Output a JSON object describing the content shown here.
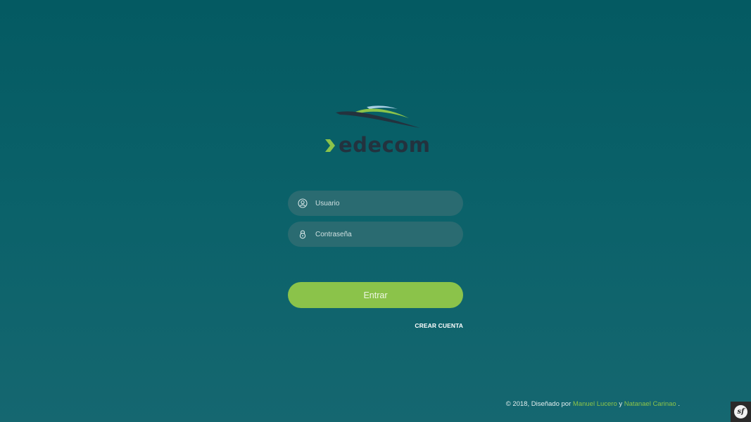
{
  "logo": {
    "text": "edecom",
    "colors": {
      "wave_light": "#a8d0e6",
      "wave_green": "#8bc34a",
      "wave_dark": "#23323e",
      "chevron": "#8bc34a",
      "text": "#23323e"
    }
  },
  "login_form": {
    "username": {
      "placeholder": "Usuario",
      "value": "",
      "icon": "user-circle-icon"
    },
    "password": {
      "placeholder": "Contraseña",
      "value": "",
      "icon": "lock-icon"
    },
    "submit_label": "Entrar",
    "create_account_label": "CREAR CUENTA"
  },
  "footer": {
    "prefix": "© 2018, Diseñado por ",
    "author1": "Manuel Lucero",
    "connector": " y ",
    "author2": "Natanael Carinao",
    "suffix": "."
  },
  "symfony_badge": {
    "label": "sf",
    "icon": "symfony-icon"
  },
  "colors": {
    "background_top": "#045a62",
    "background_bottom": "#156770",
    "field_bg": "#2a6b71",
    "accent": "#8bc34a"
  }
}
